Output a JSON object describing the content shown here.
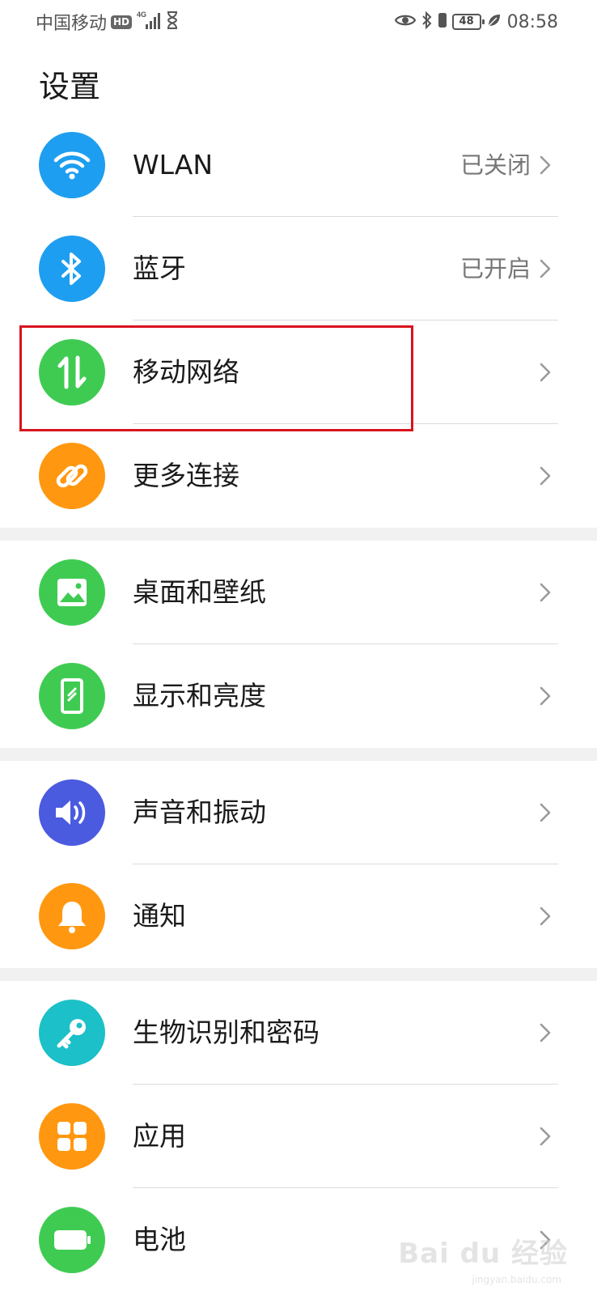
{
  "status_bar": {
    "carrier": "中国移动",
    "hd_badge": "HD",
    "network_type": "4G",
    "battery_level": "48",
    "time": "08:58"
  },
  "page_title": "设置",
  "groups": [
    {
      "items": [
        {
          "label": "WLAN",
          "value": "已关闭",
          "icon": "wifi-icon",
          "color": "#1e9ef0"
        },
        {
          "label": "蓝牙",
          "value": "已开启",
          "icon": "bluetooth-icon",
          "color": "#1e9ef0"
        },
        {
          "label": "移动网络",
          "value": "",
          "icon": "mobile-data-icon",
          "color": "#3fcb52"
        },
        {
          "label": "更多连接",
          "value": "",
          "icon": "link-icon",
          "color": "#ff9810"
        }
      ]
    },
    {
      "items": [
        {
          "label": "桌面和壁纸",
          "value": "",
          "icon": "image-icon",
          "color": "#3fcb52"
        },
        {
          "label": "显示和亮度",
          "value": "",
          "icon": "phone-display-icon",
          "color": "#3fcb52"
        }
      ]
    },
    {
      "items": [
        {
          "label": "声音和振动",
          "value": "",
          "icon": "speaker-icon",
          "color": "#4a5be0"
        },
        {
          "label": "通知",
          "value": "",
          "icon": "bell-icon",
          "color": "#ff9810"
        }
      ]
    },
    {
      "items": [
        {
          "label": "生物识别和密码",
          "value": "",
          "icon": "key-icon",
          "color": "#1cc0c8"
        },
        {
          "label": "应用",
          "value": "",
          "icon": "apps-grid-icon",
          "color": "#ff9810"
        },
        {
          "label": "电池",
          "value": "",
          "icon": "battery-icon",
          "color": "#3fcb52"
        }
      ]
    }
  ],
  "highlight_color": "#d9141f",
  "watermark": {
    "text": "Bai du 经验",
    "sub": "jingyan.baidu.com"
  }
}
